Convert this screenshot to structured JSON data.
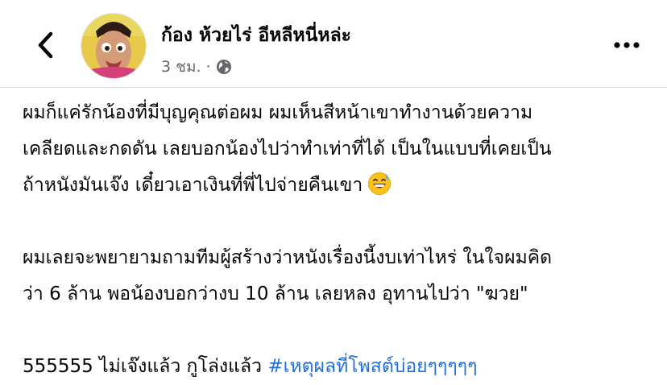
{
  "header": {
    "back_icon": "chevron-left-icon",
    "author_name": "ก้อง ห้วยไร่ อีหลีหนี่หล่ะ",
    "timestamp": "3 ชม.",
    "separator": "·",
    "privacy_icon": "globe-icon",
    "more_icon": "more-dots-icon"
  },
  "post": {
    "paragraph1": [
      "ผมก็แค่รักน้องที่มีบุญคุณต่อผม ผมเห็นสีหน้าเขาทำงานด้วยความ",
      "เคลียดและกดดัน เลยบอกน้องไปว่าทำเท่าที่ได้ เป็นในแบบที่เคยเป็น",
      "ถ้าหนังมันเจ๊ง เดี๋ยวเอาเงินที่พี่ไปจ่ายคืนเขา"
    ],
    "emoji": "grinning-sweat-emoji",
    "paragraph2": [
      "ผมเลยจะพยายามถามทีมผู้สร้างว่าหนังเรื่องนี้งบเท่าไหร่ ในใจผมคิด",
      "ว่า 6 ล้าน พอน้องบอกว่างบ 10 ล้าน เลยหลง อุทานไปว่า \"ฆวย\""
    ],
    "paragraph3_text": "555555 ไม่เจ๊งแล้ว กูโล่งแล้ว ",
    "hashtag": "#เหตุผลที่โพสต์บ่อยๆๆๆๆๆ"
  },
  "colors": {
    "text": "#050505",
    "secondary": "#65676b",
    "link": "#216fdb",
    "divider": "#dadde1"
  }
}
